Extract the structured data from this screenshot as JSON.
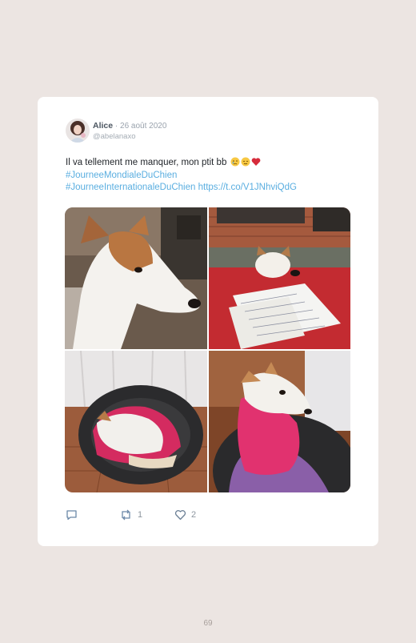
{
  "tweet": {
    "author_name": "Alice",
    "date": "26 août 2020",
    "handle": "@abelanaxo",
    "text": "Il va tellement me manquer, mon ptit bb",
    "emojis": [
      "crying-face",
      "relieved-face",
      "red-heart"
    ],
    "hashtag_1": "#JourneeMondialeDuChien",
    "hashtag_2": "#JourneeInternationaleDuChien",
    "short_link": "https://t.co/V1JNhviQdG",
    "photos": [
      "dog-portrait-profile",
      "dog-resting-on-papers",
      "dog-sleeping-in-basket",
      "dog-wrapped-in-pink-scarf"
    ]
  },
  "actions": {
    "reply_count": "",
    "retweet_count": "1",
    "like_count": "2"
  },
  "page": {
    "number": "69"
  }
}
